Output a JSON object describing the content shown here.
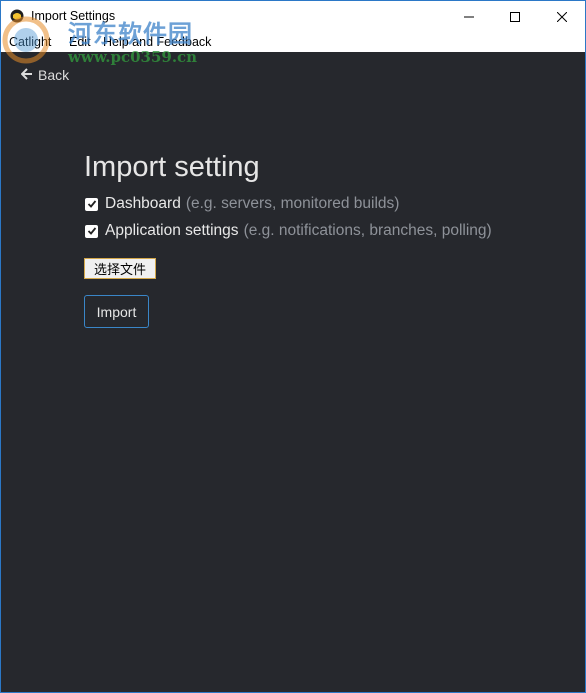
{
  "window": {
    "title": "Import Settings",
    "controls": {
      "minimize": "minimize-icon",
      "maximize": "maximize-icon",
      "close": "close-icon"
    }
  },
  "menu": {
    "items": [
      {
        "label": "Catlight"
      },
      {
        "label": "Edit"
      },
      {
        "label": "Help and Feedback"
      }
    ]
  },
  "watermark": {
    "site_name": "河东软件园",
    "url": "www.pc0359.cn"
  },
  "nav": {
    "back_label": "Back",
    "back_icon": "arrow-left-icon"
  },
  "page": {
    "heading": "Import setting",
    "options": [
      {
        "label": "Dashboard",
        "hint": "(e.g. servers, monitored builds)",
        "checked": true
      },
      {
        "label": "Application settings",
        "hint": "(e.g. notifications, branches, polling)",
        "checked": true
      }
    ],
    "file_button_label": "选择文件",
    "import_button_label": "Import"
  },
  "colors": {
    "background": "#26282d",
    "accent_border": "#3a86c8",
    "hint_text": "#8e9299"
  }
}
